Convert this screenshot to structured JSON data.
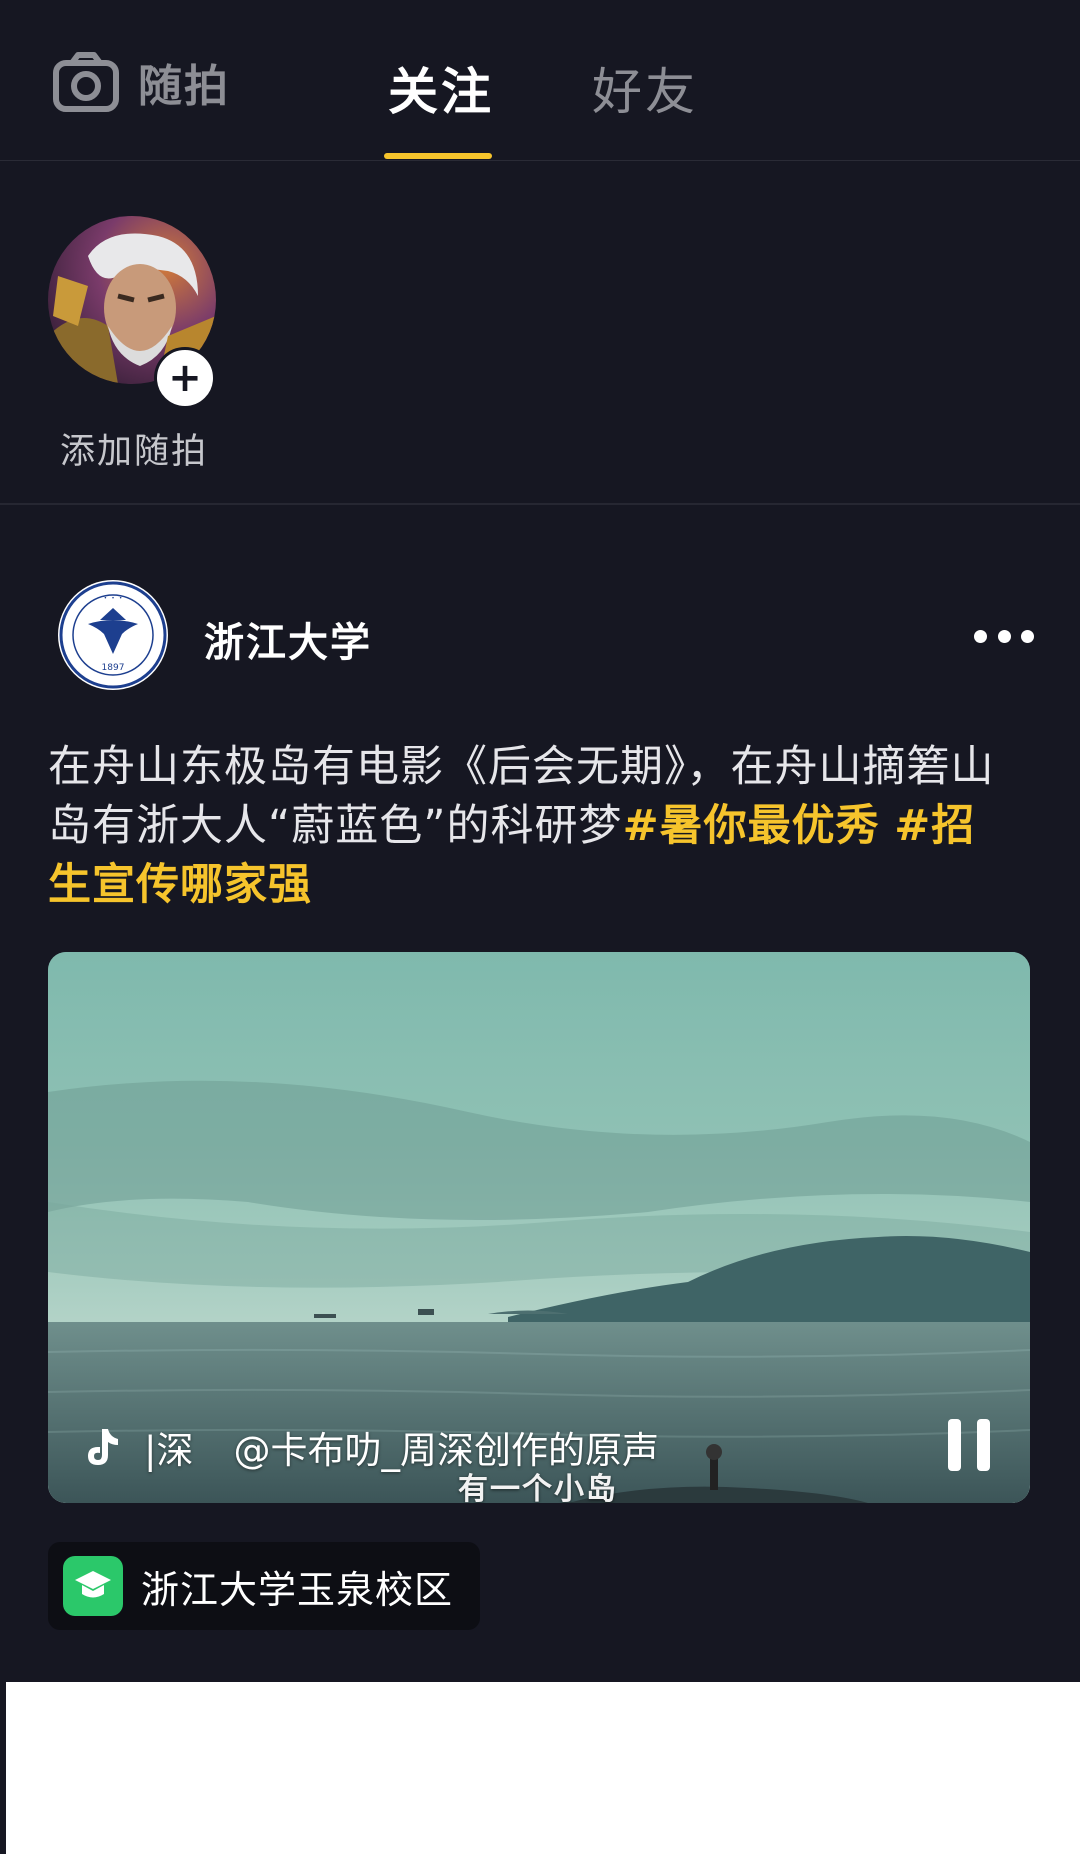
{
  "topbar": {
    "suipai_label": "随拍",
    "tabs": [
      {
        "label": "关注",
        "active": true
      },
      {
        "label": "好友",
        "active": false
      }
    ],
    "accent_color": "#f6c42c"
  },
  "stories": {
    "add_label": "添加随拍",
    "plus_symbol": "+"
  },
  "post": {
    "author": "浙江大学",
    "text_plain": "在舟山东极岛有电影《后会无期》，在舟山摘箬山岛有浙大人“蔚蓝色”的科研梦",
    "tags": [
      "#暑你最优秀",
      "#招生宣传哪家强"
    ],
    "video": {
      "music_short": "|深",
      "music_credit": "@卡布叻_周深创作的原声",
      "subtitle": "有一个小岛"
    },
    "location": "浙江大学玉泉校区"
  },
  "icons": {
    "camera": "camera-icon",
    "more": "more-dots-icon",
    "music": "douyin-note-icon",
    "pause": "pause-icon",
    "location": "graduation-cap-icon"
  }
}
